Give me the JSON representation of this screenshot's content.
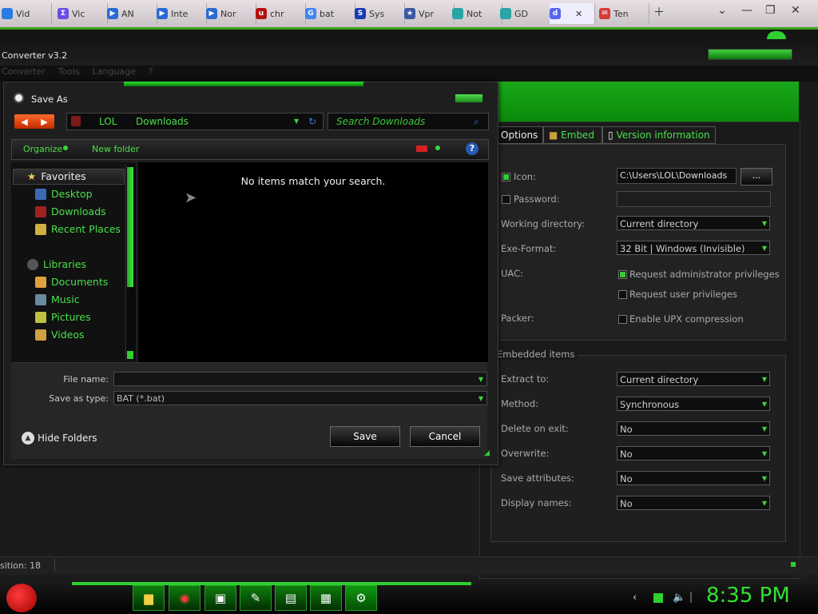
{
  "browser": {
    "tabs": [
      {
        "label": "Vid",
        "icon": "app-icon",
        "color": "#2a7be4"
      },
      {
        "label": "Vic",
        "icon": "app-icon",
        "color": "#6a4be4"
      },
      {
        "label": "AN",
        "icon": "play-icon",
        "color": "#2a6ad4"
      },
      {
        "label": "Inte",
        "icon": "play-icon",
        "color": "#2a6ad4"
      },
      {
        "label": "Nor",
        "icon": "play-icon",
        "color": "#2a6ad4"
      },
      {
        "label": "chr",
        "icon": "ublock-icon",
        "color": "#b41010"
      },
      {
        "label": "bat",
        "icon": "google-icon",
        "color": "#4285f4"
      },
      {
        "label": "Sys",
        "icon": "s-icon",
        "color": "#1a3ab4"
      },
      {
        "label": "Vpr",
        "icon": "star-icon",
        "color": "#3a5aa4"
      },
      {
        "label": "Not",
        "icon": "app-icon",
        "color": "#2aa4a4"
      },
      {
        "label": "GD",
        "icon": "app-icon",
        "color": "#2aa4a4"
      },
      {
        "label": "",
        "icon": "discord-icon",
        "color": "#5865f2"
      },
      {
        "label": "Ten",
        "icon": "mail-icon",
        "color": "#d43a3a"
      }
    ]
  },
  "app": {
    "title": "Converter v3.2",
    "menu": [
      "Converter",
      "Tools",
      "Language",
      "?"
    ],
    "tabs": [
      {
        "label": "Options",
        "selected": true
      },
      {
        "label": "Embed",
        "selected": false
      },
      {
        "label": "Version information",
        "selected": false
      }
    ],
    "options": {
      "icon_label": "Icon:",
      "icon_value": "C:\\Users\\LOL\\Downloads",
      "browse_label": "...",
      "password_label": "Password:",
      "working_dir_label": "Working directory:",
      "working_dir_value": "Current directory",
      "exe_format_label": "Exe-Format:",
      "exe_format_value": "32 Bit | Windows (Invisible)",
      "uac_label": "UAC:",
      "uac_admin_label": "Request administrator privileges",
      "uac_user_label": "Request user privileges",
      "packer_label": "Packer:",
      "upx_label": "Enable UPX compression"
    },
    "embedded": {
      "group_label": "Embedded items",
      "extract_label": "Extract to:",
      "extract_value": "Current directory",
      "method_label": "Method:",
      "method_value": "Synchronous",
      "delete_label": "Delete on exit:",
      "delete_value": "No",
      "overwrite_label": "Overwrite:",
      "overwrite_value": "No",
      "save_attr_label": "Save attributes:",
      "save_attr_value": "No",
      "display_names_label": "Display names:",
      "display_names_value": "No"
    },
    "status": "sition: 18"
  },
  "dialog": {
    "title": "Save As",
    "path": [
      "LOL",
      "Downloads"
    ],
    "search_placeholder": "Search Downloads",
    "organize_label": "Organize",
    "new_folder_label": "New folder",
    "help_label": "?",
    "favorites_label": "Favorites",
    "favorites": [
      "Desktop",
      "Downloads",
      "Recent Places"
    ],
    "libraries_label": "Libraries",
    "libraries": [
      "Documents",
      "Music",
      "Pictures",
      "Videos"
    ],
    "empty_message": "No items match your search.",
    "file_name_label": "File name:",
    "file_name_value": "",
    "save_type_label": "Save as type:",
    "save_type_value": "BAT (*.bat)",
    "hide_folders_label": "Hide Folders",
    "save_label": "Save",
    "cancel_label": "Cancel"
  },
  "taskbar": {
    "clock": "8:35 PM"
  }
}
